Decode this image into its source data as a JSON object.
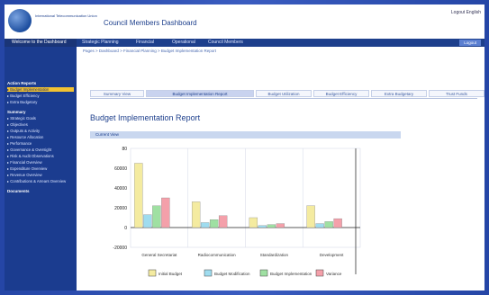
{
  "header": {
    "org_name": "International Telecommunication Union",
    "app_title": "Council Members Dashboard",
    "user_link": "Logout  English"
  },
  "nav": {
    "left": "Welcome to the Dashboard",
    "items": [
      "Strategic Planning",
      "Financial",
      "Operational",
      "Council Members"
    ],
    "logout": "Logout"
  },
  "breadcrumb": "Pages > Dashboard > Financial Planning > Budget Implementation Report",
  "sidebar": {
    "sections": [
      {
        "title": "Action Reports",
        "items": [
          {
            "label": "Budget Implementation",
            "active": true
          },
          {
            "label": "Budget Efficiency",
            "active": false
          },
          {
            "label": "Extra Budgetary",
            "active": false
          }
        ]
      },
      {
        "title": "Summary",
        "items": [
          {
            "label": "Strategic Goals",
            "active": false
          },
          {
            "label": "Objectives",
            "active": false
          },
          {
            "label": "Outputs & Activity",
            "active": false
          },
          {
            "label": "Resource Allocation",
            "active": false
          },
          {
            "label": "Performance",
            "active": false
          },
          {
            "label": "Governance & Oversight",
            "active": false
          },
          {
            "label": "Risk & Audit Observations",
            "active": false
          },
          {
            "label": "Financial Overview",
            "active": false
          },
          {
            "label": "Expenditure Overview",
            "active": false
          },
          {
            "label": "Revenue Overview",
            "active": false
          },
          {
            "label": "Contributions & Arrears Overview",
            "active": false
          }
        ]
      },
      {
        "title": "Documents",
        "items": []
      }
    ]
  },
  "tabs": [
    {
      "label": "Summary View",
      "active": false
    },
    {
      "label": "Budget Implementation Report",
      "active": true
    },
    {
      "label": "Budget Utilization",
      "active": false
    },
    {
      "label": "Budget Efficiency",
      "active": false
    },
    {
      "label": "Extra Budgetary",
      "active": false
    },
    {
      "label": "Trust Funds",
      "active": false
    }
  ],
  "page_title": "Budget Implementation Report",
  "panel_title": "Current View",
  "chart_data": {
    "type": "bar",
    "categories": [
      "General Secretariat",
      "Radiocommunication",
      "Standardization",
      "Development"
    ],
    "series": [
      {
        "name": "Initial Budget",
        "color": "#f4eba0",
        "values": [
          65,
          26,
          10,
          22
        ]
      },
      {
        "name": "Budget Modification",
        "color": "#9fdcef",
        "values": [
          13,
          5,
          2,
          4
        ]
      },
      {
        "name": "Budget Implementation",
        "color": "#9fe0a2",
        "values": [
          22,
          8,
          3,
          6
        ]
      },
      {
        "name": "Variance",
        "color": "#f4a0aa",
        "values": [
          30,
          12,
          4,
          9
        ]
      }
    ],
    "y_ticks": [
      "80",
      "60000",
      "40000",
      "20000",
      "0",
      "-20000"
    ],
    "ylim": [
      -20,
      80
    ],
    "y_zero_value": 0
  }
}
